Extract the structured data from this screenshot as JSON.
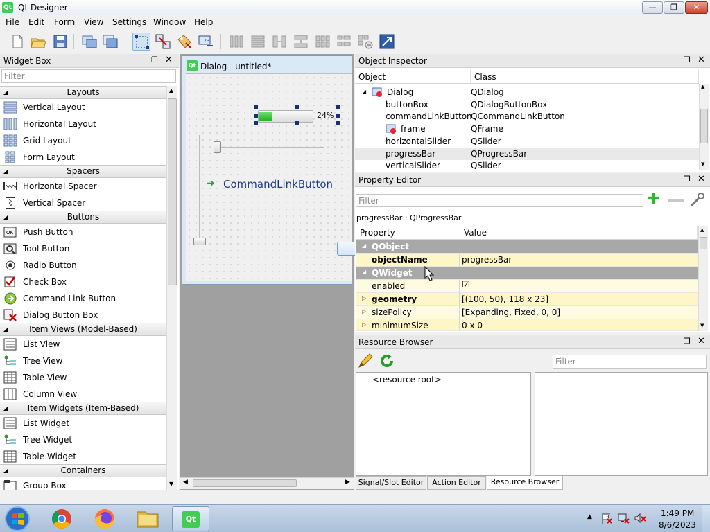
{
  "window": {
    "title": "Qt Designer",
    "min": "—",
    "max": "❐",
    "close": "✕",
    "icon": "Qt"
  },
  "menu": [
    "File",
    "Edit",
    "Form",
    "View",
    "Settings",
    "Window",
    "Help"
  ],
  "widget_box": {
    "title": "Widget Box",
    "filter_placeholder": "Filter",
    "categories": [
      {
        "name": "Layouts",
        "items": [
          "Vertical Layout",
          "Horizontal Layout",
          "Grid Layout",
          "Form Layout"
        ]
      },
      {
        "name": "Spacers",
        "items": [
          "Horizontal Spacer",
          "Vertical Spacer"
        ]
      },
      {
        "name": "Buttons",
        "items": [
          "Push Button",
          "Tool Button",
          "Radio Button",
          "Check Box",
          "Command Link Button",
          "Dialog Button Box"
        ]
      },
      {
        "name": "Item Views (Model-Based)",
        "items": [
          "List View",
          "Tree View",
          "Table View",
          "Column View"
        ]
      },
      {
        "name": "Item Widgets (Item-Based)",
        "items": [
          "List Widget",
          "Tree Widget",
          "Table Widget"
        ]
      },
      {
        "name": "Containers",
        "items": [
          "Group Box"
        ]
      }
    ]
  },
  "form": {
    "title": "Dialog - untitled*",
    "progress_text": "24%",
    "progress": 0.24,
    "command_link_text": "CommandLinkButton"
  },
  "object_inspector": {
    "title": "Object Inspector",
    "col_object": "Object",
    "col_class": "Class",
    "rows": [
      {
        "object": "Dialog",
        "class": "QDialog"
      },
      {
        "object": "buttonBox",
        "class": "QDialogButtonBox"
      },
      {
        "object": "commandLinkButton",
        "class": "QCommandLinkButton"
      },
      {
        "object": "frame",
        "class": "QFrame"
      },
      {
        "object": "horizontalSlider",
        "class": "QSlider"
      },
      {
        "object": "progressBar",
        "class": "QProgressBar"
      },
      {
        "object": "verticalSlider",
        "class": "QSlider"
      }
    ]
  },
  "property_editor": {
    "title": "Property Editor",
    "filter_placeholder": "Filter",
    "object_label": "progressBar : QProgressBar",
    "col_property": "Property",
    "col_value": "Value",
    "rows": [
      {
        "name": "QObject",
        "value": ""
      },
      {
        "name": "objectName",
        "value": "progressBar"
      },
      {
        "name": "QWidget",
        "value": ""
      },
      {
        "name": "enabled",
        "value": "☑"
      },
      {
        "name": "geometry",
        "value": "[(100, 50), 118 x 23]"
      },
      {
        "name": "sizePolicy",
        "value": "[Expanding, Fixed, 0, 0]"
      },
      {
        "name": "minimumSize",
        "value": "0 x 0"
      }
    ]
  },
  "resource_browser": {
    "title": "Resource Browser",
    "filter_placeholder": "Filter",
    "root": "<resource root>"
  },
  "bottom_tabs": [
    "Signal/Slot Editor",
    "Action Editor",
    "Resource Browser"
  ],
  "taskbar": {
    "time": "1:49 PM",
    "date": "8/6/2023"
  },
  "colors": {
    "accent": "#41cd52",
    "selection": "#cfe3f6",
    "group_row": "#a8a8a8"
  }
}
